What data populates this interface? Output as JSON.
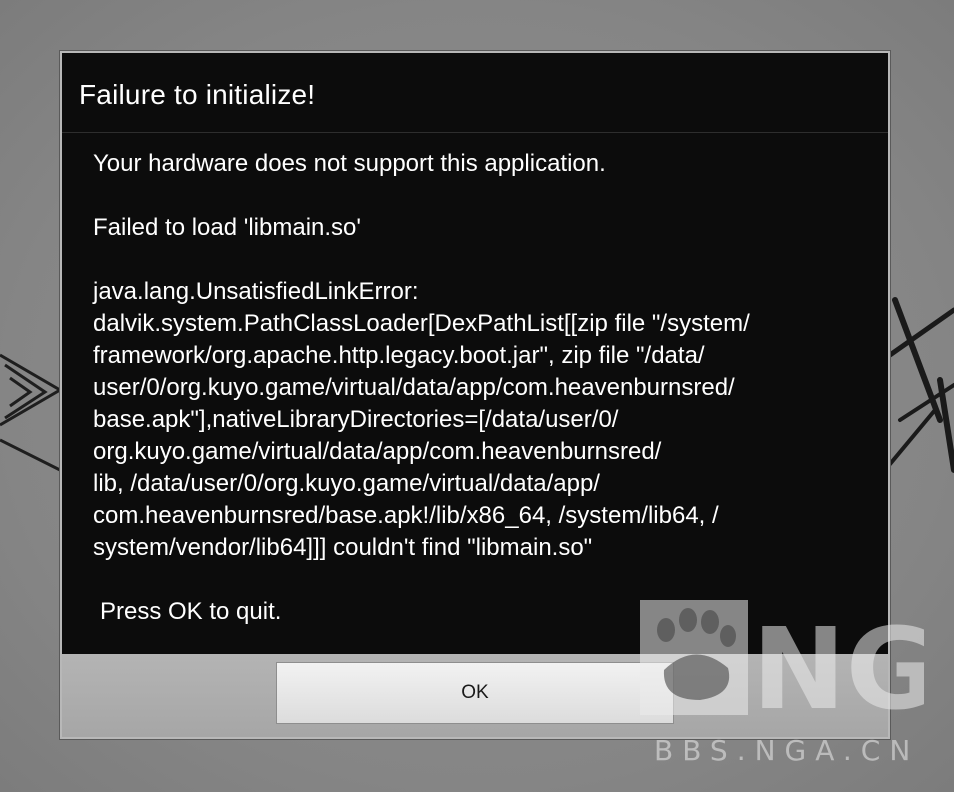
{
  "dialog": {
    "title": "Failure to initialize!",
    "message_lines": [
      "Your hardware does not support this application.",
      "",
      "Failed to load 'libmain.so'",
      "",
      "java.lang.UnsatisfiedLinkError:",
      "dalvik.system.PathClassLoader[DexPathList[[zip file \"/system/",
      "framework/org.apache.http.legacy.boot.jar\", zip file \"/data/",
      "user/0/org.kuyo.game/virtual/data/app/com.heavenburnsred/",
      "base.apk\"],nativeLibraryDirectories=[/data/user/0/",
      "org.kuyo.game/virtual/data/app/com.heavenburnsred/",
      "lib, /data/user/0/org.kuyo.game/virtual/data/app/",
      "com.heavenburnsred/base.apk!/lib/x86_64, /system/lib64, /",
      "system/vendor/lib64]]] couldn't find \"libmain.so\"",
      "",
      " Press OK to quit."
    ],
    "ok_label": "OK"
  },
  "watermark": {
    "logo_text": "NGA",
    "site_text": "BBS.NGA.CN"
  },
  "colors": {
    "dialog_bg": "#0c0c0c",
    "dialog_text": "#ffffff",
    "button_bar": "#ababab",
    "button_bg": "#e8e8e8",
    "backdrop": "#8a8a8a"
  }
}
